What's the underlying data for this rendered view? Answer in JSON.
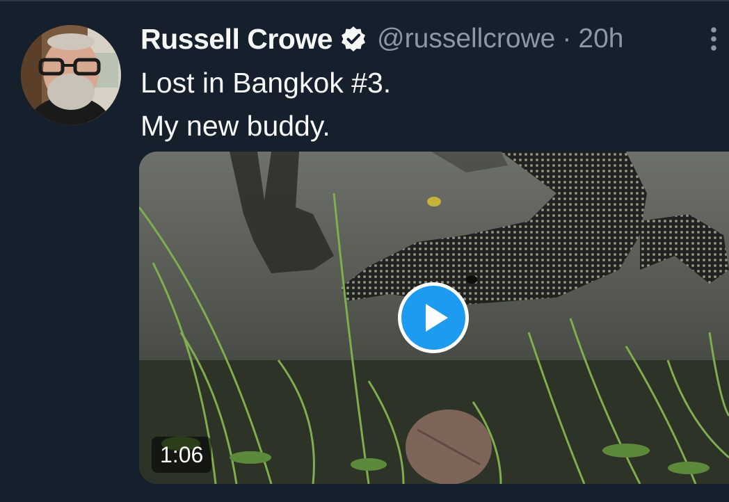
{
  "tweet": {
    "author": {
      "display_name": "Russell Crowe",
      "handle": "@russellcrowe",
      "verified": true
    },
    "separator": "·",
    "timestamp": "20h",
    "text_lines": [
      "Lost in Bangkok #3.",
      "My new buddy."
    ],
    "media": {
      "type": "video",
      "duration": "1:06"
    }
  },
  "colors": {
    "background": "#16202c",
    "text_primary": "#f7f9f9",
    "text_secondary": "#8b98a5",
    "accent": "#1d9bf0"
  },
  "icons": {
    "verified": "verified-badge-icon",
    "more": "more-options-icon",
    "play": "play-icon"
  }
}
